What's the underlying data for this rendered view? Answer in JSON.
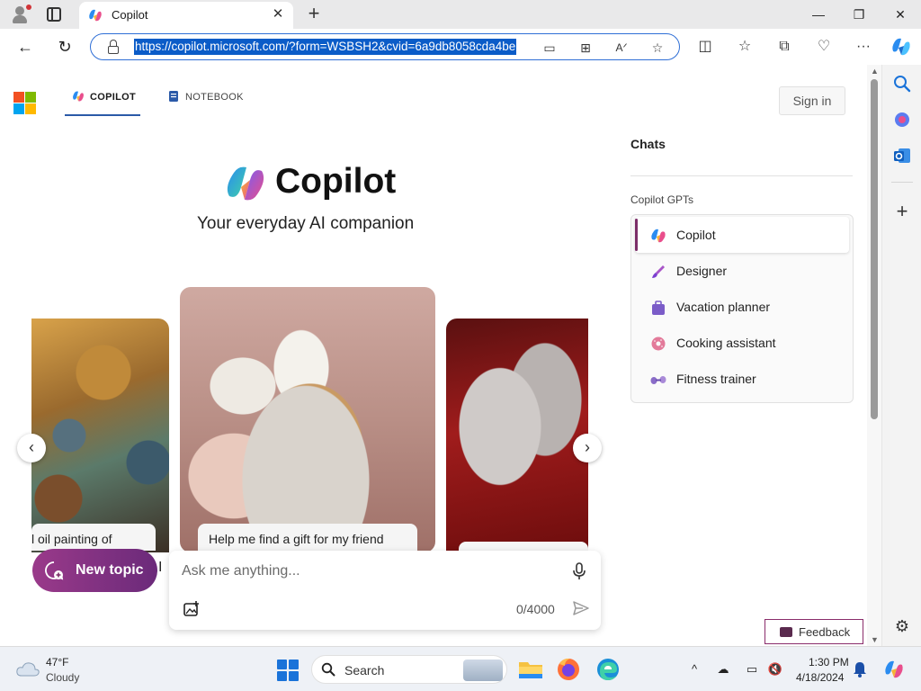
{
  "browser": {
    "tab_title": "Copilot",
    "url": "https://copilot.microsoft.com/?form=WSBSH2&cvid=6a9db8058cda4be",
    "window_controls": {
      "minimize": "—",
      "restore": "❐",
      "close": "✕"
    }
  },
  "header": {
    "nav_tabs": [
      {
        "label": "COPILOT",
        "selected": true
      },
      {
        "label": "NOTEBOOK",
        "selected": false
      }
    ],
    "sign_in_label": "Sign in"
  },
  "hero": {
    "title": "Copilot",
    "subtitle": "Your everyday AI companion"
  },
  "carousel": {
    "cards": [
      {
        "caption": "l oil painting of"
      },
      {
        "caption": "Help me find a gift for my friend"
      },
      {
        "caption": ""
      }
    ]
  },
  "composer": {
    "new_topic_label": "New topic",
    "placeholder": "Ask me anything...",
    "counter": "0/4000"
  },
  "side_panel": {
    "chats_title": "Chats",
    "gpts_title": "Copilot GPTs",
    "gpts": [
      {
        "label": "Copilot",
        "icon": "copilot-icon",
        "selected": true
      },
      {
        "label": "Designer",
        "icon": "designer-icon",
        "selected": false
      },
      {
        "label": "Vacation planner",
        "icon": "suitcase-icon",
        "selected": false
      },
      {
        "label": "Cooking assistant",
        "icon": "donut-icon",
        "selected": false
      },
      {
        "label": "Fitness trainer",
        "icon": "dumbbell-icon",
        "selected": false
      }
    ],
    "feedback_label": "Feedback"
  },
  "taskbar": {
    "weather_temp": "47°F",
    "weather_condition": "Cloudy",
    "search_label": "Search",
    "time": "1:30 PM",
    "date": "4/18/2024"
  },
  "colors": {
    "accent": "#2f6fd6",
    "url_highlight": "#0b5cc8",
    "new_topic_start": "#9a3a8a",
    "new_topic_end": "#6b2a7a",
    "gpt_active_bar": "#7b2d68"
  }
}
